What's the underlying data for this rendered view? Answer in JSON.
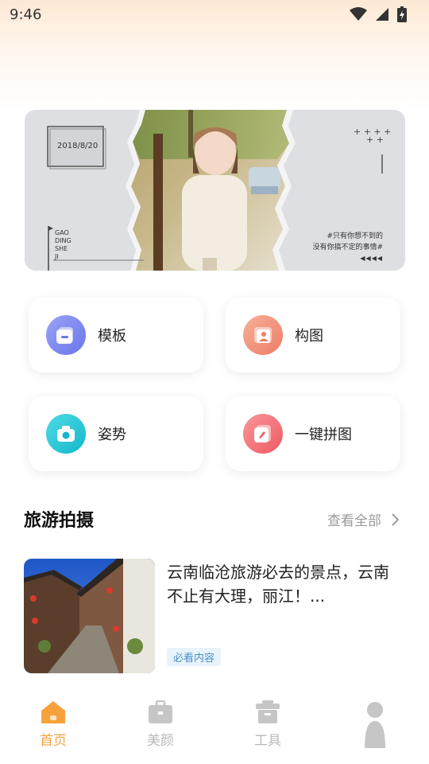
{
  "status_bar": {
    "time": "9:46"
  },
  "banner": {
    "date": "2018/8/20",
    "vertical_text": [
      "GAO",
      "DING",
      "SHE",
      "JI"
    ],
    "quote_line1": "#只有你想不到的",
    "quote_line2": "没有你搞不定的事情#",
    "arrows": "◀◀◀◀"
  },
  "features": [
    {
      "label": "模板",
      "icon": "template-icon",
      "color": "#7b86f0"
    },
    {
      "label": "构图",
      "icon": "composition-icon",
      "color": "#f2937a"
    },
    {
      "label": "姿势",
      "icon": "camera-icon",
      "color": "#22c8d6"
    },
    {
      "label": "一键拼图",
      "icon": "collage-icon",
      "color": "#f36f73"
    }
  ],
  "section": {
    "title": "旅游拍摄",
    "view_all": "查看全部"
  },
  "article": {
    "title": "云南临沧旅游必去的景点，云南不止有大理，丽江！...",
    "tag": "必看内容"
  },
  "bottom_nav": [
    {
      "label": "首页",
      "icon": "home-icon",
      "active": true
    },
    {
      "label": "美颜",
      "icon": "beauty-icon",
      "active": false
    },
    {
      "label": "工具",
      "icon": "tools-icon",
      "active": false
    },
    {
      "label": "",
      "icon": "profile-icon",
      "active": false
    }
  ],
  "colors": {
    "accent": "#f6a23c",
    "inactive": "#b9b9b9"
  }
}
